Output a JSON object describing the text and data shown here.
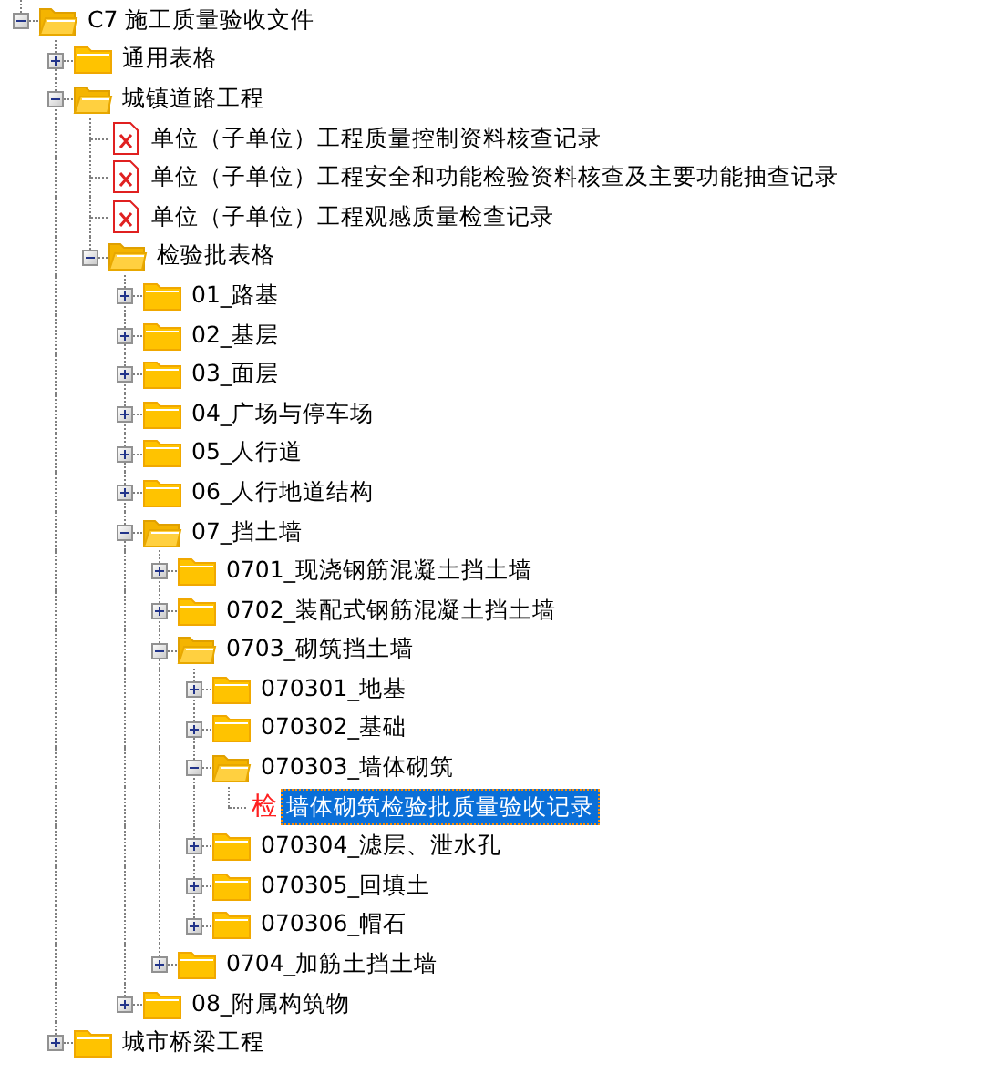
{
  "tree": [
    {
      "label": "C7 施工质量验收文件",
      "kind": "folder",
      "expanded": true,
      "selected": false,
      "children": [
        {
          "label": "通用表格",
          "kind": "folder",
          "expanded": false,
          "selected": false
        },
        {
          "label": "城镇道路工程",
          "kind": "folder",
          "expanded": true,
          "selected": false,
          "children": [
            {
              "label": "单位（子单位）工程质量控制资料核查记录",
              "kind": "document",
              "selected": false
            },
            {
              "label": "单位（子单位）工程安全和功能检验资料核查及主要功能抽查记录",
              "kind": "document",
              "selected": false
            },
            {
              "label": "单位（子单位）工程观感质量检查记录",
              "kind": "document",
              "selected": false
            },
            {
              "label": "检验批表格",
              "kind": "folder",
              "expanded": true,
              "selected": false,
              "children": [
                {
                  "label": "01_路基",
                  "kind": "folder",
                  "expanded": false,
                  "selected": false
                },
                {
                  "label": "02_基层",
                  "kind": "folder",
                  "expanded": false,
                  "selected": false
                },
                {
                  "label": "03_面层",
                  "kind": "folder",
                  "expanded": false,
                  "selected": false
                },
                {
                  "label": "04_广场与停车场",
                  "kind": "folder",
                  "expanded": false,
                  "selected": false
                },
                {
                  "label": "05_人行道",
                  "kind": "folder",
                  "expanded": false,
                  "selected": false
                },
                {
                  "label": "06_人行地道结构",
                  "kind": "folder",
                  "expanded": false,
                  "selected": false
                },
                {
                  "label": "07_挡土墙",
                  "kind": "folder",
                  "expanded": true,
                  "selected": false,
                  "children": [
                    {
                      "label": "0701_现浇钢筋混凝土挡土墙",
                      "kind": "folder",
                      "expanded": false,
                      "selected": false
                    },
                    {
                      "label": "0702_装配式钢筋混凝土挡土墙",
                      "kind": "folder",
                      "expanded": false,
                      "selected": false
                    },
                    {
                      "label": "0703_砌筑挡土墙",
                      "kind": "folder",
                      "expanded": true,
                      "selected": false,
                      "children": [
                        {
                          "label": "070301_地基",
                          "kind": "folder",
                          "expanded": false,
                          "selected": false
                        },
                        {
                          "label": "070302_基础",
                          "kind": "folder",
                          "expanded": false,
                          "selected": false
                        },
                        {
                          "label": "070303_墙体砌筑",
                          "kind": "folder",
                          "expanded": true,
                          "selected": false,
                          "children": [
                            {
                              "label": "墙体砌筑检验批质量验收记录",
                              "kind": "form",
                              "icon_text": "检",
                              "selected": true
                            }
                          ]
                        },
                        {
                          "label": "070304_滤层、泄水孔",
                          "kind": "folder",
                          "expanded": false,
                          "selected": false
                        },
                        {
                          "label": "070305_回填土",
                          "kind": "folder",
                          "expanded": false,
                          "selected": false
                        },
                        {
                          "label": "070306_帽石",
                          "kind": "folder",
                          "expanded": false,
                          "selected": false
                        }
                      ]
                    },
                    {
                      "label": "0704_加筋土挡土墙",
                      "kind": "folder",
                      "expanded": false,
                      "selected": false
                    }
                  ]
                },
                {
                  "label": "08_附属构筑物",
                  "kind": "folder",
                  "expanded": false,
                  "selected": false
                }
              ]
            }
          ]
        },
        {
          "label": "城市桥梁工程",
          "kind": "folder",
          "expanded": false,
          "selected": false
        }
      ]
    }
  ]
}
